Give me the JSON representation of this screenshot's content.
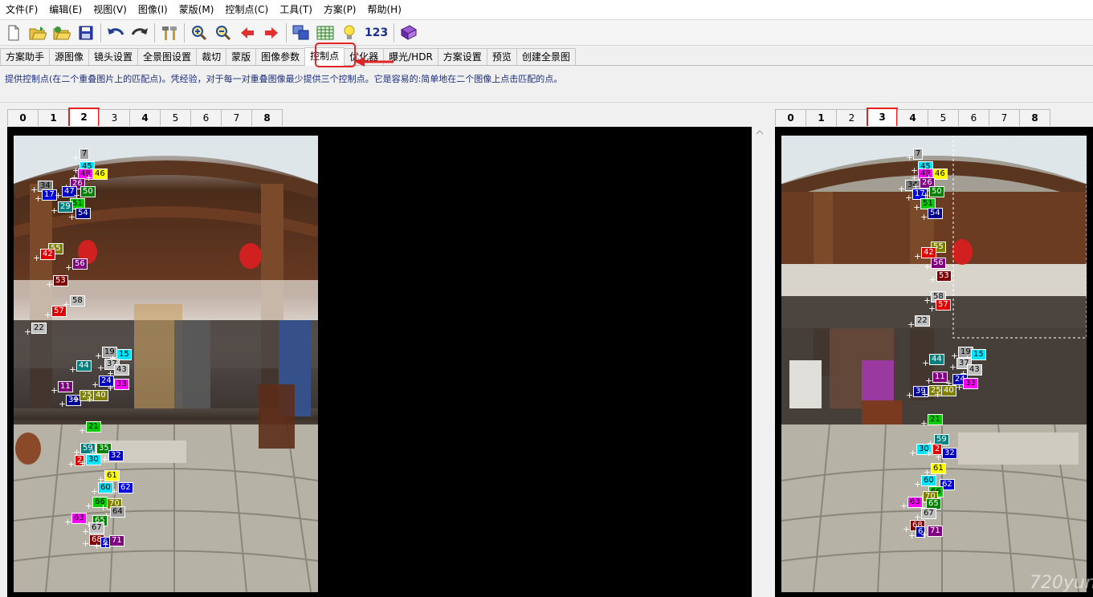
{
  "menu": [
    "文件(F)",
    "编辑(E)",
    "视图(V)",
    "图像(I)",
    "蒙版(M)",
    "控制点(C)",
    "工具(T)",
    "方案(P)",
    "帮助(H)"
  ],
  "toolbar": {
    "icons": [
      "new-file-icon",
      "open-folder-icon",
      "open-recent-icon",
      "save-icon",
      "undo-icon",
      "redo-icon",
      "tools-icon",
      "zoom-in-icon",
      "zoom-out-icon",
      "arrow-left-icon",
      "arrow-right-icon",
      "preview-windows-icon",
      "table-icon",
      "lightbulb-icon"
    ],
    "number_label": "123",
    "book_icon": "book-icon"
  },
  "tabs": [
    "方案助手",
    "源图像",
    "镜头设置",
    "全景图设置",
    "裁切",
    "蒙版",
    "图像参数",
    "控制点",
    "优化器",
    "曝光/HDR",
    "方案设置",
    "预览",
    "创建全景图"
  ],
  "active_tab_index": 7,
  "description": "提供控制点(在二个重叠图片上的匹配点)。凭经验，对于每一对重叠图像最少提供三个控制点。它是容易的:简单地在二个图像上点击匹配的点。",
  "left_tabs": [
    "0",
    "1",
    "2",
    "3",
    "4",
    "5",
    "6",
    "7",
    "8"
  ],
  "left_active": 2,
  "right_tabs": [
    "0",
    "1",
    "2",
    "3",
    "4",
    "5",
    "6",
    "7",
    "8"
  ],
  "right_active": 3,
  "watermark": "720yun",
  "colors": {
    "highlight": "#e12323",
    "desc_text": "#1d2f7d"
  },
  "left_points": [
    {
      "n": "7",
      "c": "#a0a0a0",
      "t": "#000"
    },
    {
      "n": "45",
      "c": "#00e5ff",
      "t": "#000"
    },
    {
      "n": "48",
      "c": "#ff00ff",
      "t": "#000"
    },
    {
      "n": "46",
      "c": "#ffff00",
      "t": "#000"
    },
    {
      "n": "26",
      "c": "#800080",
      "t": "#fff"
    },
    {
      "n": "34",
      "c": "#808080",
      "t": "#000"
    },
    {
      "n": "17",
      "c": "#0000e0",
      "t": "#fff"
    },
    {
      "n": "47",
      "c": "#0000c0",
      "t": "#fff"
    },
    {
      "n": "50",
      "c": "#008000",
      "t": "#fff"
    },
    {
      "n": "51",
      "c": "#00cc00",
      "t": "#000"
    },
    {
      "n": "29",
      "c": "#008080",
      "t": "#fff"
    },
    {
      "n": "54",
      "c": "#000090",
      "t": "#fff"
    },
    {
      "n": "55",
      "c": "#808000",
      "t": "#fff"
    },
    {
      "n": "42",
      "c": "#e00000",
      "t": "#fff"
    },
    {
      "n": "56",
      "c": "#800080",
      "t": "#fff"
    },
    {
      "n": "53",
      "c": "#800000",
      "t": "#fff"
    },
    {
      "n": "58",
      "c": "#c0c0c0",
      "t": "#000"
    },
    {
      "n": "57",
      "c": "#e00000",
      "t": "#fff"
    },
    {
      "n": "22",
      "c": "#c0c0c0",
      "t": "#000"
    },
    {
      "n": "19",
      "c": "#a0a0a0",
      "t": "#000"
    },
    {
      "n": "15",
      "c": "#00e5ff",
      "t": "#000"
    },
    {
      "n": "44",
      "c": "#008080",
      "t": "#fff"
    },
    {
      "n": "37",
      "c": "#c0c0c0",
      "t": "#000"
    },
    {
      "n": "43",
      "c": "#c0c0c0",
      "t": "#000"
    },
    {
      "n": "11",
      "c": "#800080",
      "t": "#fff"
    },
    {
      "n": "24",
      "c": "#0000c0",
      "t": "#fff"
    },
    {
      "n": "33",
      "c": "#ff00ff",
      "t": "#000"
    },
    {
      "n": "39",
      "c": "#000090",
      "t": "#fff"
    },
    {
      "n": "25",
      "c": "#808000",
      "t": "#fff"
    },
    {
      "n": "40",
      "c": "#808000",
      "t": "#fff"
    },
    {
      "n": "21",
      "c": "#00cc00",
      "t": "#000"
    },
    {
      "n": "59",
      "c": "#008080",
      "t": "#fff"
    },
    {
      "n": "35",
      "c": "#008000",
      "t": "#fff"
    },
    {
      "n": "2",
      "c": "#e00000",
      "t": "#fff"
    },
    {
      "n": "30",
      "c": "#00e5ff",
      "t": "#000"
    },
    {
      "n": "32",
      "c": "#0000c0",
      "t": "#fff"
    },
    {
      "n": "61",
      "c": "#ffff00",
      "t": "#000"
    },
    {
      "n": "60",
      "c": "#00e5ff",
      "t": "#000"
    },
    {
      "n": "62",
      "c": "#0000e0",
      "t": "#fff"
    },
    {
      "n": "66",
      "c": "#00cc00",
      "t": "#000"
    },
    {
      "n": "70",
      "c": "#808000",
      "t": "#fff"
    },
    {
      "n": "64",
      "c": "#a0a0a0",
      "t": "#000"
    },
    {
      "n": "63",
      "c": "#ff00ff",
      "t": "#000"
    },
    {
      "n": "65",
      "c": "#008000",
      "t": "#fff"
    },
    {
      "n": "67",
      "c": "#c0c0c0",
      "t": "#000"
    },
    {
      "n": "68",
      "c": "#800000",
      "t": "#fff"
    },
    {
      "n": "6",
      "c": "#0000c0",
      "t": "#fff"
    },
    {
      "n": "71",
      "c": "#800080",
      "t": "#fff"
    }
  ],
  "right_points": [
    {
      "n": "7",
      "c": "#a0a0a0",
      "t": "#000"
    },
    {
      "n": "45",
      "c": "#00e5ff",
      "t": "#000"
    },
    {
      "n": "48",
      "c": "#ff00ff",
      "t": "#000"
    },
    {
      "n": "46",
      "c": "#ffff00",
      "t": "#000"
    },
    {
      "n": "34",
      "c": "#808080",
      "t": "#000"
    },
    {
      "n": "26",
      "c": "#800080",
      "t": "#fff"
    },
    {
      "n": "17",
      "c": "#0000e0",
      "t": "#fff"
    },
    {
      "n": "50",
      "c": "#008000",
      "t": "#fff"
    },
    {
      "n": "51",
      "c": "#00cc00",
      "t": "#000"
    },
    {
      "n": "54",
      "c": "#000090",
      "t": "#fff"
    },
    {
      "n": "55",
      "c": "#808000",
      "t": "#fff"
    },
    {
      "n": "42",
      "c": "#e00000",
      "t": "#fff"
    },
    {
      "n": "56",
      "c": "#800080",
      "t": "#fff"
    },
    {
      "n": "53",
      "c": "#800000",
      "t": "#fff"
    },
    {
      "n": "58",
      "c": "#c0c0c0",
      "t": "#000"
    },
    {
      "n": "57",
      "c": "#e00000",
      "t": "#fff"
    },
    {
      "n": "22",
      "c": "#c0c0c0",
      "t": "#000"
    },
    {
      "n": "19",
      "c": "#a0a0a0",
      "t": "#000"
    },
    {
      "n": "15",
      "c": "#00e5ff",
      "t": "#000"
    },
    {
      "n": "44",
      "c": "#008080",
      "t": "#fff"
    },
    {
      "n": "37",
      "c": "#c0c0c0",
      "t": "#000"
    },
    {
      "n": "43",
      "c": "#c0c0c0",
      "t": "#000"
    },
    {
      "n": "11",
      "c": "#800080",
      "t": "#fff"
    },
    {
      "n": "24",
      "c": "#0000c0",
      "t": "#fff"
    },
    {
      "n": "33",
      "c": "#ff00ff",
      "t": "#000"
    },
    {
      "n": "39",
      "c": "#000090",
      "t": "#fff"
    },
    {
      "n": "25",
      "c": "#808000",
      "t": "#fff"
    },
    {
      "n": "40",
      "c": "#808000",
      "t": "#fff"
    },
    {
      "n": "21",
      "c": "#00cc00",
      "t": "#000"
    },
    {
      "n": "59",
      "c": "#008080",
      "t": "#fff"
    },
    {
      "n": "30",
      "c": "#00e5ff",
      "t": "#000"
    },
    {
      "n": "2",
      "c": "#e00000",
      "t": "#fff"
    },
    {
      "n": "32",
      "c": "#0000c0",
      "t": "#fff"
    },
    {
      "n": "61",
      "c": "#ffff00",
      "t": "#000"
    },
    {
      "n": "60",
      "c": "#00e5ff",
      "t": "#000"
    },
    {
      "n": "62",
      "c": "#0000e0",
      "t": "#fff"
    },
    {
      "n": "66",
      "c": "#00cc00",
      "t": "#000"
    },
    {
      "n": "70",
      "c": "#808000",
      "t": "#fff"
    },
    {
      "n": "63",
      "c": "#ff00ff",
      "t": "#000"
    },
    {
      "n": "65",
      "c": "#008000",
      "t": "#fff"
    },
    {
      "n": "67",
      "c": "#c0c0c0",
      "t": "#000"
    },
    {
      "n": "68",
      "c": "#800000",
      "t": "#fff"
    },
    {
      "n": "6",
      "c": "#0000c0",
      "t": "#fff"
    },
    {
      "n": "71",
      "c": "#800080",
      "t": "#fff"
    }
  ]
}
